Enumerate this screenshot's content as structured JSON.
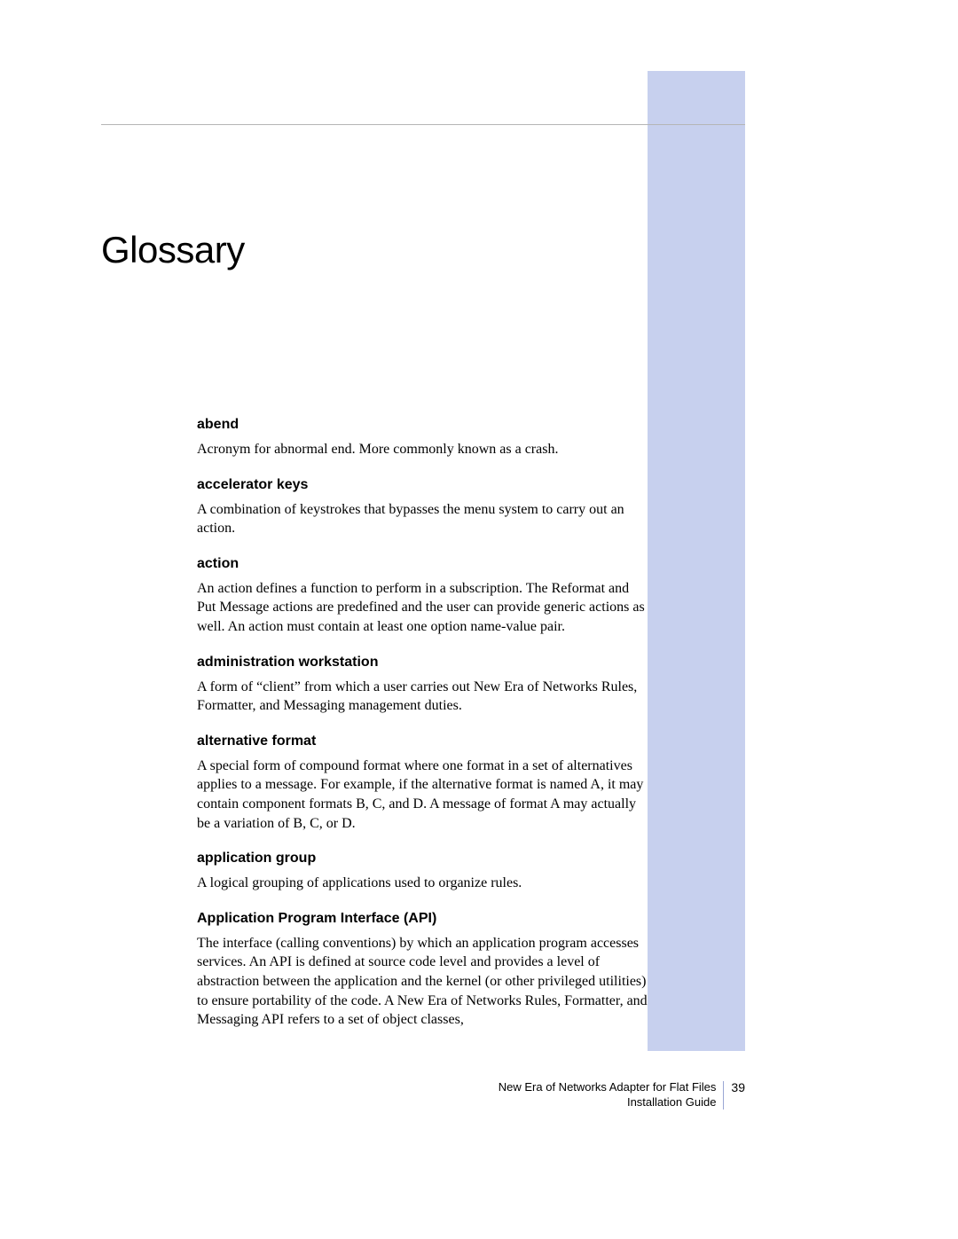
{
  "title": "Glossary",
  "entries": [
    {
      "term": "abend",
      "definition": "Acronym for abnormal end. More commonly known as a crash."
    },
    {
      "term": "accelerator keys",
      "definition": "A combination of keystrokes that bypasses the menu system to carry out an action."
    },
    {
      "term": "action",
      "definition": "An action defines a function to perform in a subscription. The Reformat and Put Message actions are predefined and the user can provide generic actions as well. An action must contain at least one option name-value pair."
    },
    {
      "term": "administration workstation",
      "definition": "A form of “client” from which a user carries out New Era of Networks Rules, Formatter, and Messaging management duties."
    },
    {
      "term": "alternative format",
      "definition": "A special form of compound format where one format in a set of alternatives applies to a message. For example, if the alternative format is named A, it may contain component formats B, C, and D. A message of format A may actually be a variation of B, C, or D."
    },
    {
      "term": "application group",
      "definition": "A logical grouping of applications used to organize rules."
    },
    {
      "term": "Application Program Interface (API)",
      "definition": "The interface (calling conventions) by which an application program accesses services. An API is defined at source code level and provides a level of abstraction between the application and the kernel (or other privileged utilities) to ensure portability of the code. A New Era of Networks Rules, Formatter, and Messaging API refers to a set of object classes,"
    }
  ],
  "footer": {
    "line1": "New Era of Networks Adapter for Flat Files",
    "line2": "Installation Guide",
    "page": "39"
  }
}
